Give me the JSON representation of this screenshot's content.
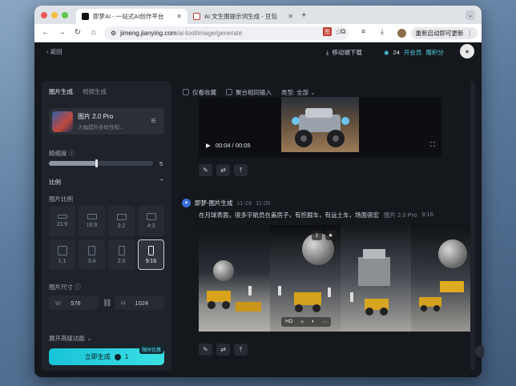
{
  "browser": {
    "tabs": [
      {
        "title": "即梦AI - 一站式AI创作平台",
        "active": true
      },
      {
        "title": "AI 文生图提示词生成 - 豆包",
        "active": false
      }
    ],
    "new_tab": "+",
    "url_host": "jimeng.jianying.com",
    "url_path": "/ai-tool/image/generate",
    "restart_label": "重新启动即可更新",
    "ext_label": "图"
  },
  "header": {
    "back_label": "返回",
    "download_label": "移动端下载",
    "credit_count": "24",
    "vip_label": "开会员",
    "free_label": "赠积分"
  },
  "left": {
    "tabs": [
      "图片生成",
      "视频生成"
    ],
    "model": {
      "name": "图片 2.0 Pro",
      "desc": "大幅提升多样性和..."
    },
    "precision_label": "精细度",
    "precision_value": "5",
    "precision_fraction": 0.45,
    "ratio_section": "比例",
    "ratio_label": "图片比例",
    "ratios": [
      "21:9",
      "16:9",
      "3:2",
      "4:3",
      "1:1",
      "3:4",
      "2:3",
      "9:16"
    ],
    "selected_ratio": "9:16",
    "size_label": "图片尺寸",
    "width_key": "W",
    "width_value": "576",
    "height_key": "H",
    "height_value": "1024",
    "advanced_label": "展开高级功能",
    "generate_label": "立即生成",
    "generate_cost": "1",
    "promo_label": "限时优惠"
  },
  "content": {
    "filters": {
      "only_fav": "仅看收藏",
      "merge": "聚合相同输入",
      "type_label": "类型: 全部"
    },
    "video": {
      "time": "00:04 / 00:05"
    },
    "result": {
      "author": "即梦-图片生成",
      "date": "11-26",
      "time": "11:09",
      "prompt": "在月球表面，很多宇航员在盖房子，有挖掘车，有运土车，场面很宏",
      "model": "图片 2.0 Pro",
      "ratio": "9:16",
      "hd_label": "HD"
    }
  },
  "colors": {
    "accent": "#19c3d8",
    "panel": "#1e2229",
    "window": "#14171c"
  }
}
